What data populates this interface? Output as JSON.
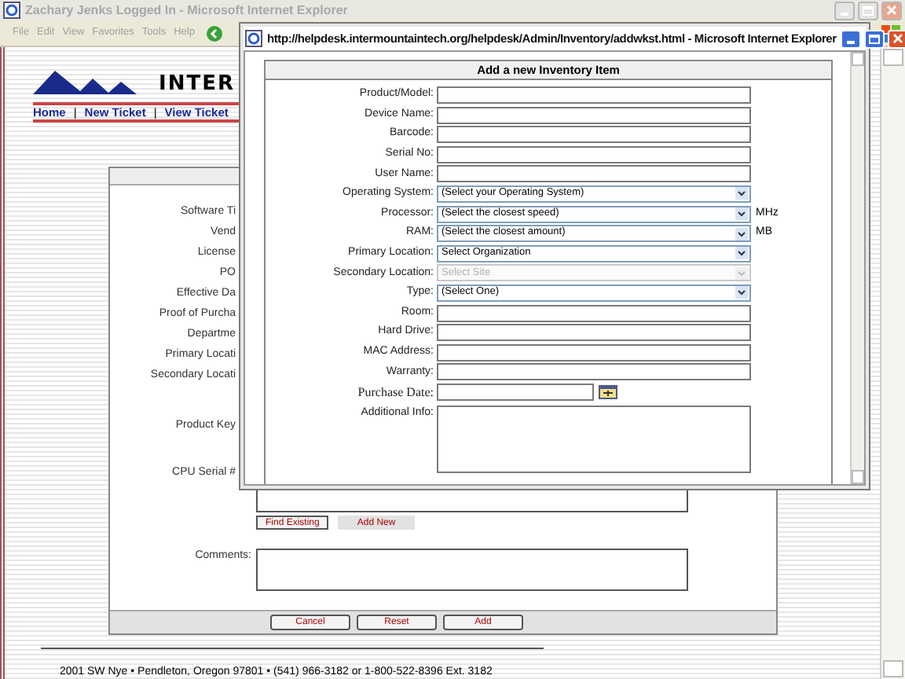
{
  "main_window": {
    "title": "Zachary Jenks Logged In - Microsoft Internet Explorer",
    "menu": [
      "File",
      "Edit",
      "View",
      "Favorites",
      "Tools",
      "Help"
    ]
  },
  "site": {
    "logo_text": "INTER",
    "nav": [
      {
        "kind": "link",
        "label": "Home"
      },
      {
        "kind": "separator",
        "label": "|"
      },
      {
        "kind": "link",
        "label": "New Ticket"
      },
      {
        "kind": "separator",
        "label": "|"
      },
      {
        "kind": "link",
        "label": "View Ticket"
      }
    ]
  },
  "background_form": {
    "labels": [
      "Software Ti",
      "Vend",
      "License",
      "PO",
      "Effective Da",
      "Proof of Purcha",
      "Departme",
      "Primary Locati",
      "Secondary Locati",
      "Product Key",
      "CPU Serial #"
    ],
    "buttons": [
      {
        "label": "Find Existing",
        "selected": true
      },
      {
        "label": "Add New",
        "selected": false
      }
    ],
    "comments_label": "Comments:",
    "footer_buttons": [
      "Cancel",
      "Reset",
      "Add"
    ]
  },
  "footer": "2001 SW Nye • Pendleton, Oregon 97801 • (541) 966-3182 or 1-800-522-8396 Ext. 3182",
  "popup": {
    "title": "http://helpdesk.intermountaintech.org/helpdesk/Admin/Inventory/addwkst.html - Microsoft Internet Explorer",
    "heading": "Add a new Inventory Item",
    "fields": [
      {
        "kind": "text",
        "label": "Product/Model:"
      },
      {
        "kind": "text",
        "label": "Device Name:"
      },
      {
        "kind": "text",
        "label": "Barcode:"
      },
      {
        "kind": "text",
        "label": "Serial No:"
      },
      {
        "kind": "text",
        "label": "User Name:"
      },
      {
        "kind": "select",
        "label": "Operating System:",
        "value": "(Select your Operating System)",
        "disabled": false
      },
      {
        "kind": "select",
        "label": "Processor:",
        "value": "(Select the closest speed)",
        "unit": "MHz",
        "disabled": false
      },
      {
        "kind": "select",
        "label": "RAM:",
        "value": "(Select the closest amount)",
        "unit": "MB",
        "disabled": false
      },
      {
        "kind": "select",
        "label": "Primary Location:",
        "value": "Select Organization",
        "disabled": false
      },
      {
        "kind": "select",
        "label": "Secondary Location:",
        "value": "Select Site",
        "disabled": true
      },
      {
        "kind": "select",
        "label": "Type:",
        "value": "(Select One)",
        "disabled": false
      },
      {
        "kind": "text",
        "label": "Room:"
      },
      {
        "kind": "text",
        "label": "Hard Drive:"
      },
      {
        "kind": "text",
        "label": "MAC Address:"
      },
      {
        "kind": "text",
        "label": "Warranty:"
      },
      {
        "kind": "date",
        "label": "Purchase Date:"
      },
      {
        "kind": "textarea",
        "label": "Additional Info:"
      }
    ]
  }
}
